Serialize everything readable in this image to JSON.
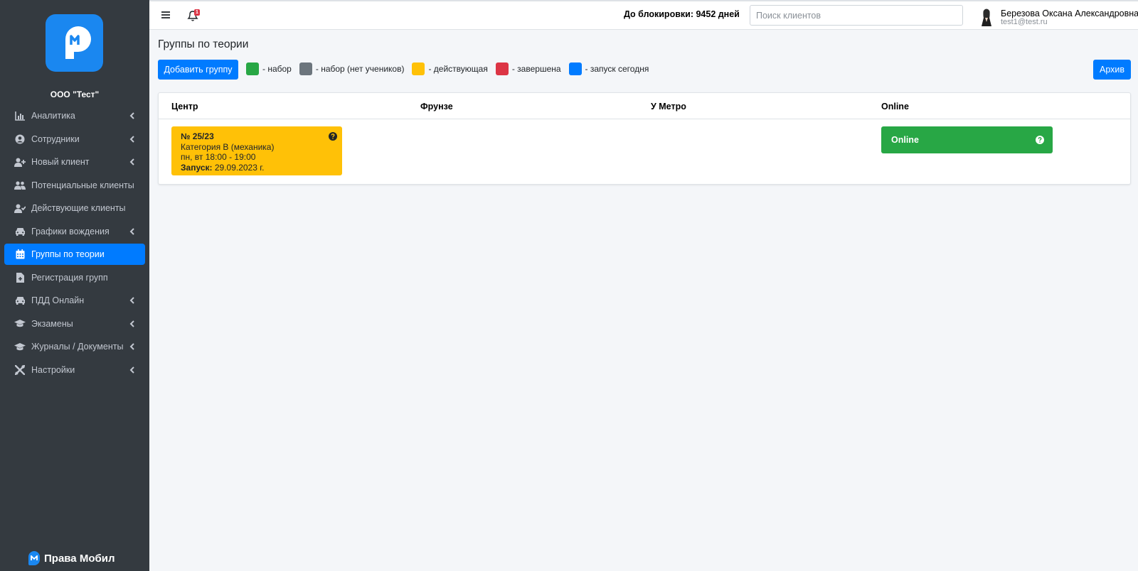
{
  "sidebar": {
    "org_name": "ООО \"Тест\"",
    "items": [
      {
        "label": "Аналитика",
        "icon": "chart-bar-icon",
        "has_submenu": true
      },
      {
        "label": "Сотрудники",
        "icon": "user-circle-icon",
        "has_submenu": true
      },
      {
        "label": "Новый клиент",
        "icon": "user-plus-icon",
        "has_submenu": true
      },
      {
        "label": "Потенциальные клиенты",
        "icon": "users-icon",
        "has_submenu": false
      },
      {
        "label": "Действующие клиенты",
        "icon": "user-check-icon",
        "has_submenu": false
      },
      {
        "label": "Графики вождения",
        "icon": "car-icon",
        "has_submenu": true
      },
      {
        "label": "Группы по теории",
        "icon": "calendar-icon",
        "has_submenu": false,
        "active": true
      },
      {
        "label": "Регистрация групп",
        "icon": "file-medical-icon",
        "has_submenu": false
      },
      {
        "label": "ПДД Онлайн",
        "icon": "car-icon",
        "has_submenu": true
      },
      {
        "label": "Экзамены",
        "icon": "graduation-cap-icon",
        "has_submenu": true
      },
      {
        "label": "Журналы / Документы",
        "icon": "graduation-cap-icon",
        "has_submenu": true
      },
      {
        "label": "Настройки",
        "icon": "tools-icon",
        "has_submenu": true
      }
    ],
    "brand": "Права Мобил"
  },
  "topbar": {
    "block_info": "До блокировки: 9452 дней",
    "notification_count": "1",
    "search_placeholder": "Поиск клиентов",
    "user_name": "Березова Оксана Александровна",
    "user_email": "test1@test.ru"
  },
  "main": {
    "title": "Группы по теории",
    "add_button": "Добавить группу",
    "archive_button": "Архив",
    "legend": [
      {
        "label": "- набор",
        "color": "#28a745"
      },
      {
        "label": "- набор (нет учеников)",
        "color": "#6c757d"
      },
      {
        "label": "- действующая",
        "color": "#ffc107"
      },
      {
        "label": "- завершена",
        "color": "#dc3545"
      },
      {
        "label": "- запуск сегодня",
        "color": "#007bff"
      }
    ],
    "columns": [
      "Центр",
      "Фрунзе",
      "У Метро",
      "Online"
    ],
    "group": {
      "number": "№ 25/23",
      "category": "Категория B (механика)",
      "schedule": "пн, вт 18:00 - 19:00",
      "launch_label": "Запуск:",
      "launch_date": "29.09.2023 г."
    },
    "online_card": "Online"
  },
  "colors": {
    "sidebar_bg": "#343a40",
    "accent": "#007bff",
    "active_group": "#ffc107",
    "online": "#28a745"
  }
}
